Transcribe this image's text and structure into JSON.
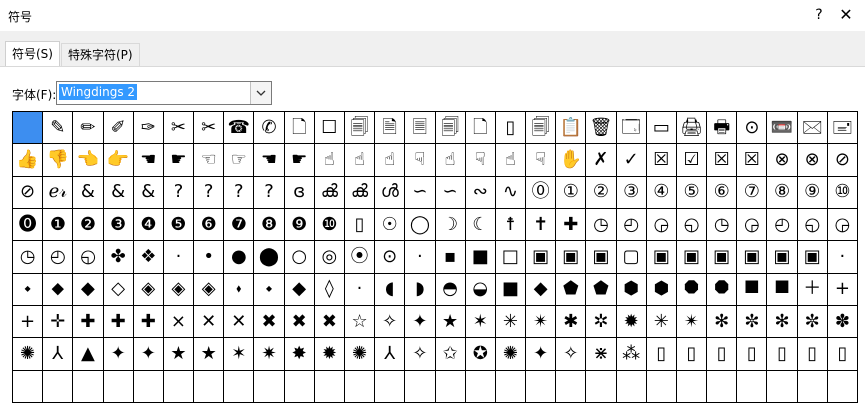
{
  "window": {
    "title": "符号",
    "help": "?",
    "close": "✕"
  },
  "tabs": [
    {
      "label": "符号(S)",
      "active": true
    },
    {
      "label": "特殊字符(P)",
      "active": false
    }
  ],
  "font": {
    "label": "字体(F):",
    "value": "Wingdings 2"
  },
  "selected_index": 0,
  "symbols": [
    "",
    "✎",
    "✏",
    "✐",
    "✑",
    "✂",
    "✂",
    "☎",
    "✆",
    "🗋",
    "☐",
    "🗐",
    "🗎",
    "🗏",
    "🗐",
    "🗋",
    "▯",
    "🗐",
    "📋",
    "🗑",
    "🗔",
    "▭",
    "🖨",
    "🖶",
    "⊙",
    "📼",
    "🖂",
    "🖃",
    "👍",
    "👎",
    "👈",
    "👉",
    "☚",
    "☛",
    "☜",
    "☞",
    "☚",
    "☛",
    "☝",
    "☝",
    "☝",
    "☟",
    "☝",
    "☟",
    "☝",
    "☟",
    "✋",
    "✗",
    "✓",
    "☒",
    "☑",
    "☒",
    "☒",
    "⊗",
    "⊗",
    "⊘",
    "⊘",
    "ℯ𝓇",
    "&",
    "&",
    "&",
    "?",
    "?",
    "?",
    "?",
    "ɞ",
    "ൿ",
    "ൿ",
    "ൾ",
    "∽",
    "∽",
    "∾",
    "∿",
    "⓪",
    "①",
    "②",
    "③",
    "④",
    "⑤",
    "⑥",
    "⑦",
    "⑧",
    "⑨",
    "⑩",
    "⓿",
    "❶",
    "❷",
    "❸",
    "❹",
    "❺",
    "❻",
    "❼",
    "❽",
    "❾",
    "❿",
    "▯",
    "☉",
    "◯",
    "☽",
    "☾",
    "☨",
    "✝",
    "✚",
    "◷",
    "◴",
    "◶",
    "◵",
    "◷",
    "◶",
    "◴",
    "◵",
    "◶",
    "◷",
    "◴",
    "◵",
    "✤",
    "❖",
    "·",
    "•",
    "●",
    "⬤",
    "○",
    "◎",
    "⦿",
    "⊙",
    "·",
    "▪",
    "■",
    "□",
    "▣",
    "▣",
    "▣",
    "▢",
    "▣",
    "▣",
    "▣",
    "▣",
    "▣",
    "▣",
    "·",
    "⬩",
    "⬥",
    "◆",
    "◇",
    "◈",
    "◈",
    "◈",
    "⬪",
    "⬩",
    "◆",
    "◊",
    "·",
    "◖",
    "◗",
    "◓",
    "◒",
    "■",
    "◆",
    "⬟",
    "⬟",
    "⬢",
    "⬢",
    "⯃",
    "⯃",
    "⯀",
    "⯀",
    "＋",
    "+",
    "+",
    "✛",
    "✚",
    "✚",
    "✚",
    "⨯",
    "✕",
    "✕",
    "✖",
    "✖",
    "✖",
    "☆",
    "✧",
    "✦",
    "★",
    "✶",
    "✳",
    "✴",
    "✱",
    "✲",
    "✹",
    "✳",
    "✴",
    "✻",
    "✼",
    "✻",
    "✼",
    "✽",
    "✺",
    "⅄",
    "▲",
    "✦",
    "✦",
    "★",
    "★",
    "✶",
    "✷",
    "✸",
    "✹",
    "✺",
    "⅄",
    "✧",
    "✩",
    "✪",
    "✺",
    "✦",
    "✧",
    "⋇",
    "⁂",
    "▯",
    "▯",
    "▯",
    "▯",
    "▯",
    "▯",
    "▯",
    "",
    "",
    "",
    "",
    "",
    "",
    "",
    "",
    "",
    "",
    "",
    "",
    "",
    "",
    "",
    "",
    "",
    "",
    "",
    "",
    "",
    "",
    "",
    "",
    "",
    "",
    "",
    ""
  ]
}
